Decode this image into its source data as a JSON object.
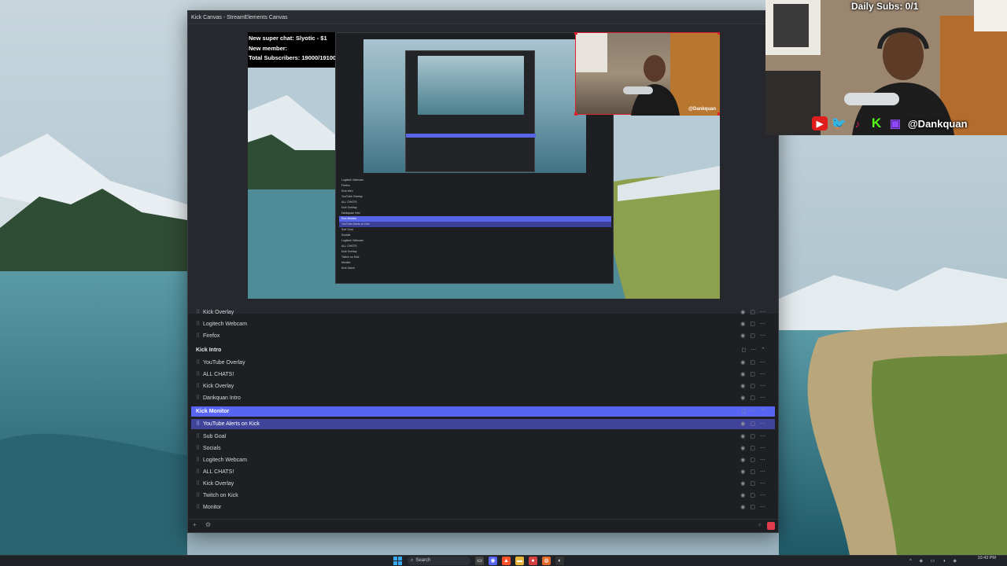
{
  "window": {
    "title": "Kick Canvas - StreamElements Canvas"
  },
  "chat_overlay": {
    "line1": "New super chat: Slyotic - $1",
    "line2": "New member:",
    "line3": "Total Subscribers: 19000/19100"
  },
  "cam_small": {
    "handle": "@Dankquan"
  },
  "sources": [
    {
      "type": "item",
      "label": "Kick Overlay",
      "partial": true
    },
    {
      "type": "item",
      "label": "Logitech Webcam"
    },
    {
      "type": "item",
      "label": "Firefox"
    },
    {
      "type": "group",
      "label": "Kick Intro"
    },
    {
      "type": "item",
      "label": "YouTube Overlay"
    },
    {
      "type": "item",
      "label": "ALL CHATS!"
    },
    {
      "type": "item",
      "label": "Kick Overlay"
    },
    {
      "type": "item",
      "label": "Dankquan Intro"
    },
    {
      "type": "group",
      "label": "Kick Monitor",
      "state": "selected-group"
    },
    {
      "type": "item",
      "label": "YouTube Alerts on Kick",
      "state": "selected"
    },
    {
      "type": "item",
      "label": "Sub Goal"
    },
    {
      "type": "item",
      "label": "Socials"
    },
    {
      "type": "item",
      "label": "Logitech Webcam"
    },
    {
      "type": "item",
      "label": "ALL CHATS!"
    },
    {
      "type": "item",
      "label": "Kick Overlay"
    },
    {
      "type": "item",
      "label": "Twitch on Kick"
    },
    {
      "type": "item",
      "label": "Monitor"
    },
    {
      "type": "group",
      "label": "Kick Game",
      "partial": true
    }
  ],
  "nested_list": [
    "Logitech Webcam",
    "Firefox",
    "Kick Intro",
    "YouTube Overlay",
    "ALL CHATS!",
    "Kick Overlay",
    "Dankquan Intro",
    "Kick Monitor",
    "YouTube Alerts on Kick",
    "Sub Goal",
    "Socials",
    "Logitech Webcam",
    "ALL CHATS!",
    "Kick Overlay",
    "Twitch on Kick",
    "Monitor",
    "Kick Game"
  ],
  "webcam": {
    "daily_subs": "Daily Subs: 0/1",
    "handle": "@Dankquan"
  },
  "taskbar": {
    "search_placeholder": "Search",
    "time": "10:43 PM"
  },
  "colors": {
    "selected_group": "#5865f2",
    "selected_item": "#3f4499",
    "record": "#e03a4e"
  }
}
